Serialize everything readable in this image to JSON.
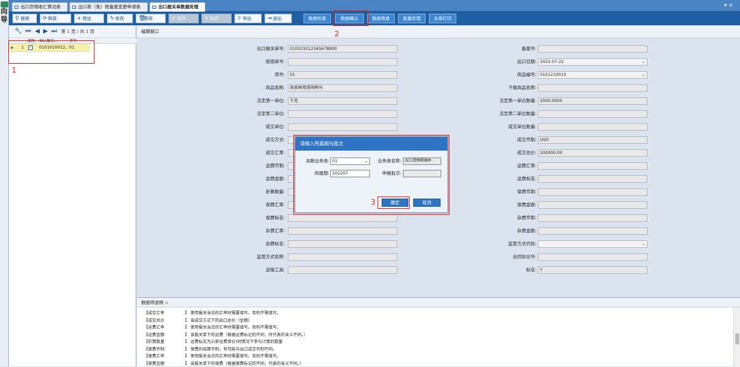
{
  "nav": {
    "label1": "向",
    "label2": "导"
  },
  "tabs": [
    {
      "label": "出口货物收汇情况表"
    },
    {
      "label": "出口若（免）税备案变更申请表"
    },
    {
      "label": "出口报关单数据处理"
    }
  ],
  "tabmenu": "▾ ×",
  "toolbar": {
    "search": "搜索",
    "refresh": "刷新",
    "add": "增加",
    "edit": "修改",
    "delete": "删除",
    "save": "保存",
    "cancel": "放弃",
    "import": "导出",
    "exit": "退出",
    "check": "数据检查",
    "confirm": "数据确认",
    "restore": "数据恢复",
    "batch": "批量处理",
    "print": "关单打印"
  },
  "left": {
    "pager": "第 1 页 / 共 1 页",
    "grid": {
      "headers": [
        "选择",
        "出口报关...",
        "项号"
      ],
      "rows": [
        {
          "no": "1",
          "decl": "0101010012...",
          "item": "01"
        }
      ]
    }
  },
  "main": {
    "header": "编辑窗口"
  },
  "form": {
    "left": [
      {
        "label": "出口报关单号:",
        "value": "010101012345678900"
      },
      {
        "label": "核销单号:",
        "value": ""
      },
      {
        "label": "项号:",
        "value": "01"
      },
      {
        "label": "商品名称:",
        "value": "改良种用浸壳鸭马"
      },
      {
        "label": "法定第一单位:",
        "value": "千克"
      },
      {
        "label": "法定第二单位:",
        "value": ""
      },
      {
        "label": "成交单位:",
        "value": ""
      },
      {
        "label": "成交方式:",
        "value": ""
      },
      {
        "label": "成交汇率:",
        "value": ""
      },
      {
        "label": "运费币制:",
        "value": ""
      },
      {
        "label": "运费金额:",
        "value": ""
      },
      {
        "label": "折算数量:",
        "value": ""
      },
      {
        "label": "保费汇率:",
        "value": ""
      },
      {
        "label": "保费标志:",
        "value": ""
      },
      {
        "label": "杂费汇率:",
        "value": ""
      },
      {
        "label": "杂费标志:",
        "value": ""
      },
      {
        "label": "监管方式名称:",
        "value": ""
      },
      {
        "label": "运输工具:",
        "value": ""
      }
    ],
    "right": [
      {
        "label": "备案号:",
        "value": "",
        "select": false
      },
      {
        "label": "出口日期:",
        "value": "2022-07-22",
        "select": true
      },
      {
        "label": "商品编号:",
        "value": "0101210010",
        "select": true
      },
      {
        "label": "下载商品名称:",
        "value": "",
        "select": false
      },
      {
        "label": "法定第一单位数量:",
        "value": "2000.0000",
        "select": false
      },
      {
        "label": "法定第二单位数量:",
        "value": "",
        "select": false
      },
      {
        "label": "成交单位数量:",
        "value": "",
        "select": false
      },
      {
        "label": "成交币制:",
        "value": "USD",
        "select": false
      },
      {
        "label": "成交总价:",
        "value": "200000.00",
        "select": false
      },
      {
        "label": "运费汇率:",
        "value": "",
        "select": false
      },
      {
        "label": "运费标志:",
        "value": "",
        "select": false
      },
      {
        "label": "保费币制:",
        "value": "",
        "select": false
      },
      {
        "label": "保费金额:",
        "value": "",
        "select": false
      },
      {
        "label": "杂费币制:",
        "value": "",
        "select": false
      },
      {
        "label": "杂费金额:",
        "value": "",
        "select": false
      },
      {
        "label": "监管方式代码:",
        "value": "",
        "select": true
      },
      {
        "label": "合同协议号:",
        "value": "",
        "select": false
      },
      {
        "label": "标志:",
        "value": "Y",
        "select": false
      }
    ]
  },
  "note": {
    "header": "数据项说明",
    "lines": [
      {
        "k": "【成交汇率",
        "v": "】 使用报关当日的汇率时需要填写。否则不需填写。"
      },
      {
        "k": "【成交总价",
        "v": "】 该成交方式下的出口总价（金额）"
      },
      {
        "k": "【运费汇率",
        "v": "】 使用报关当日的汇率时需要填写。否则不需填写。"
      },
      {
        "k": "【运费金额",
        "v": "】 该报关单下的运费（根据运费标记的不同，所代表的含义不同。）"
      },
      {
        "k": "【折算数量",
        "v": "】 运费标志为2(即运费单价)时情况下参与计算的数量"
      },
      {
        "k": "【保费币制",
        "v": "】 保费的结算币制，有可能与出口成交币制不同。"
      },
      {
        "k": "【保费汇率",
        "v": "】 使用报关当日的汇率时需要填写。否则不需填写。"
      },
      {
        "k": "【保费金额",
        "v": "】 该报关单下的保费（根据保费标记的不同，代表的含义不同。）"
      }
    ]
  },
  "dialog": {
    "title": "请输入所属期与批次",
    "biz_label": "关联业务表:",
    "biz_value": "01",
    "bizname_label": "业务表名称:",
    "bizname_value": "出口货物明细申",
    "period_label": "所属期:",
    "period_value": "202207",
    "batch_label": "申报批次:",
    "batch_value": "",
    "ok": "确定",
    "cancel": "取消"
  },
  "annotations": {
    "n1": "1",
    "n2": "2",
    "n3": "3"
  }
}
